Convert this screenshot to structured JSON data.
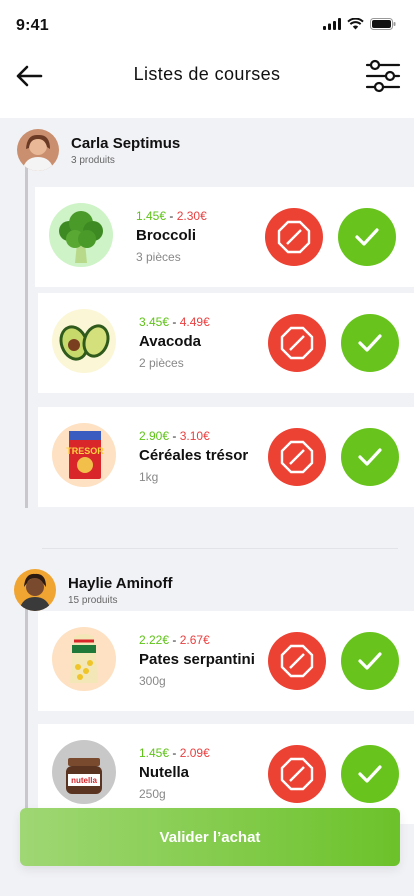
{
  "status_bar": {
    "time": "9:41"
  },
  "header": {
    "title": "Listes de courses"
  },
  "users": [
    {
      "name": "Carla Septimus",
      "count": "3 produits",
      "products": [
        {
          "min_price": "1.45€",
          "max_price": "2.30€",
          "name": "Broccoli",
          "qty": "3 pièces",
          "image": "broccoli-image"
        },
        {
          "min_price": "3.45€",
          "max_price": "4.49€",
          "name": "Avacoda",
          "qty": "2 pièces",
          "image": "avocado-image"
        },
        {
          "min_price": "2.90€",
          "max_price": "3.10€",
          "name": "Céréales trésor",
          "qty": "1kg",
          "image": "cereal-box-image"
        }
      ]
    },
    {
      "name": "Haylie Aminoff",
      "count": "15 produits",
      "products": [
        {
          "min_price": "2.22€",
          "max_price": "2.67€",
          "name": "Pates serpantini",
          "qty": "300g",
          "image": "pasta-bag-image"
        },
        {
          "min_price": "1.45€",
          "max_price": "2.09€",
          "name": "Nutella",
          "qty": "250g",
          "image": "nutella-jar-image"
        }
      ]
    }
  ],
  "price_separator": "-",
  "cereal_box_text": "TRESOR",
  "nutella_label": "nutella",
  "validate_button": "Valider l’achat",
  "colors": {
    "accept": "#68c41d",
    "refuse": "#ec4234",
    "price_min": "#5fc318",
    "price_max": "#e84040"
  }
}
